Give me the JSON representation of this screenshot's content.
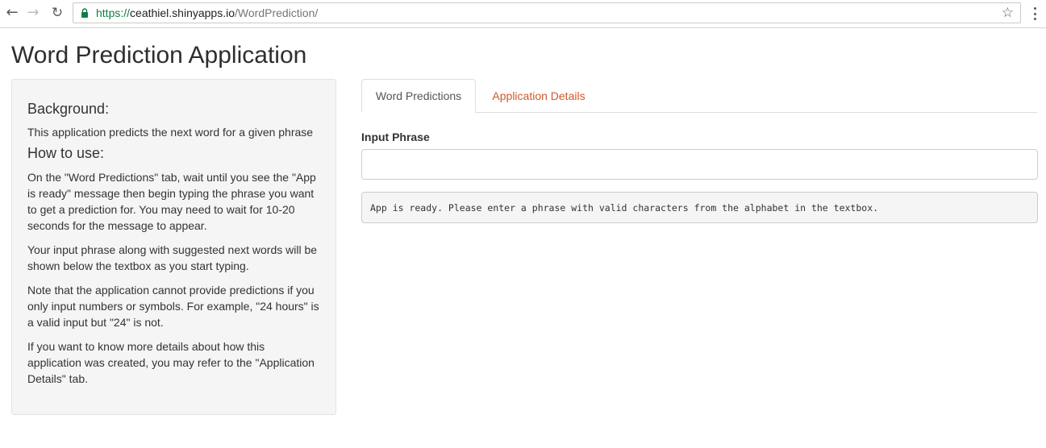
{
  "browser": {
    "url_scheme": "https://",
    "url_host": "ceathiel.shinyapps.io",
    "url_path": "/WordPrediction/",
    "icons": [
      "back-arrow-icon",
      "forward-arrow-icon",
      "reload-icon",
      "lock-icon",
      "star-icon",
      "menu-dots-icon"
    ]
  },
  "page": {
    "title": "Word Prediction Application"
  },
  "sidebar": {
    "background_heading": "Background:",
    "background_text": "This application predicts the next word for a given phrase",
    "how_heading": "How to use:",
    "how_text_1": "On the \"Word Predictions\" tab, wait until you see the \"App is ready\" message then begin typing the phrase you want to get a prediction for. You may need to wait for 10-20 seconds for the message to appear.",
    "how_text_2": "Your input phrase along with suggested next words will be shown below the textbox as you start typing.",
    "how_text_3": "Note that the application cannot provide predictions if you only input numbers or symbols. For example, \"24 hours\" is a valid input but \"24\" is not.",
    "how_text_4": "If you want to know more details about how this application was created, you may refer to the \"Application Details\" tab."
  },
  "main": {
    "tabs": [
      {
        "label": "Word Predictions",
        "active": true
      },
      {
        "label": "Application Details",
        "active": false
      }
    ],
    "input_label": "Input Phrase",
    "input_value": "",
    "output_text": "App is ready. Please enter a phrase with valid characters from the alphabet in the textbox."
  },
  "colors": {
    "link_accent": "#d2572c",
    "secure_green": "#0b8043",
    "sidebar_bg": "#f5f5f5"
  }
}
